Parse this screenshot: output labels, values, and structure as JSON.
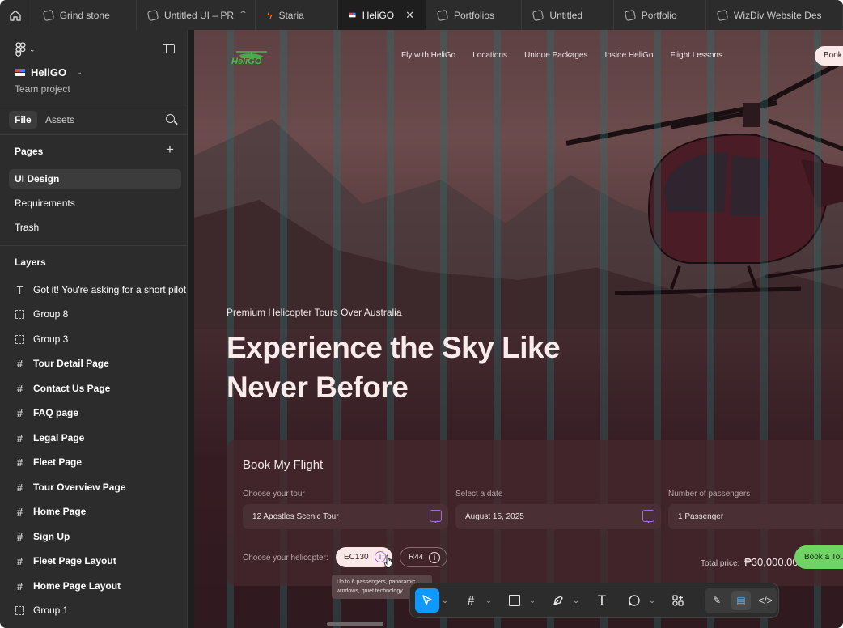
{
  "tabs": [
    {
      "label": "Grind stone",
      "icon": "figma-file-icon",
      "active": false
    },
    {
      "label": "Untitled UI – PR",
      "icon": "figma-file-icon",
      "active": false
    },
    {
      "label": "Staria",
      "icon": "bolt-icon",
      "active": false
    },
    {
      "label": "HeliGO",
      "icon": "heligo-logo-icon",
      "active": true
    },
    {
      "label": "Portfolios",
      "icon": "figma-file-icon",
      "active": false
    },
    {
      "label": "Untitled",
      "icon": "figma-file-icon",
      "active": false
    },
    {
      "label": "Portfolio",
      "icon": "figma-file-icon",
      "active": false
    },
    {
      "label": "WizDiv Website Des",
      "icon": "figma-file-icon",
      "active": false
    }
  ],
  "sidebar": {
    "project_name": "HeliGO",
    "project_sub": "Team project",
    "file_tab": "File",
    "assets_tab": "Assets",
    "pages_heading": "Pages",
    "pages": [
      {
        "label": "UI Design",
        "selected": true
      },
      {
        "label": "Requirements",
        "selected": false
      },
      {
        "label": "Trash",
        "selected": false
      }
    ],
    "layers_heading": "Layers",
    "layers": [
      {
        "label": "Got it! You're asking for a short pilot bi",
        "icon": "text-icon",
        "kind": "text"
      },
      {
        "label": "Group 8",
        "icon": "group-icon",
        "kind": "group"
      },
      {
        "label": "Group 3",
        "icon": "group-icon",
        "kind": "group"
      },
      {
        "label": "Tour Detail Page",
        "icon": "frame-icon",
        "kind": "frame"
      },
      {
        "label": "Contact Us Page",
        "icon": "frame-icon",
        "kind": "frame"
      },
      {
        "label": "FAQ page",
        "icon": "frame-icon",
        "kind": "frame"
      },
      {
        "label": "Legal Page",
        "icon": "frame-icon",
        "kind": "frame"
      },
      {
        "label": "Fleet Page",
        "icon": "frame-icon",
        "kind": "frame"
      },
      {
        "label": "Tour Overview Page",
        "icon": "frame-icon",
        "kind": "frame"
      },
      {
        "label": "Home Page",
        "icon": "frame-icon",
        "kind": "frame"
      },
      {
        "label": "Sign Up",
        "icon": "frame-icon",
        "kind": "frame"
      },
      {
        "label": "Fleet Page Layout",
        "icon": "frame-icon",
        "kind": "frame"
      },
      {
        "label": "Home Page Layout",
        "icon": "frame-icon",
        "kind": "frame"
      },
      {
        "label": "Group 1",
        "icon": "group-icon",
        "kind": "group"
      }
    ]
  },
  "site": {
    "logo_text": "HeliGO",
    "nav": [
      "Fly with HeliGo",
      "Locations",
      "Unique Packages",
      "Inside HeliGo",
      "Flight Lessons"
    ],
    "nav_cta": "Book",
    "hero_sub": "Premium Helicopter Tours Over Australia",
    "hero_title_line1": "Experience the Sky Like",
    "hero_title_line2": "Never Before",
    "booking": {
      "title": "Book My Flight",
      "tour_label": "Choose your tour",
      "tour_value": "12 Apostles Scenic Tour",
      "date_label": "Select a date",
      "date_value": "August 15, 2025",
      "passengers_label": "Number of passengers",
      "passengers_value": "1 Passenger",
      "helicopter_label": "Choose your helicopter:",
      "helicopters": [
        "EC130",
        "R44"
      ],
      "selected_helicopter": "EC130",
      "tooltip": "Up to 6 passengers, panoramic windows, quiet technology",
      "total_label": "Total price:",
      "total_value": "₱30,000.00",
      "cta": "Book a Tour"
    }
  },
  "colors": {
    "accent_blue": "#0d99ff",
    "cta_green": "#6fd463",
    "logo_green": "#3fbf4a",
    "purple_icon": "#a86fd0"
  },
  "toolbar": {
    "tools": [
      "move-tool",
      "frame-tool",
      "rectangle-tool",
      "pen-tool",
      "text-tool",
      "comment-tool",
      "actions-tool"
    ],
    "selected_tool": "move-tool",
    "modes": [
      "draw-mode",
      "design-mode",
      "dev-mode"
    ],
    "active_mode": "design-mode"
  }
}
